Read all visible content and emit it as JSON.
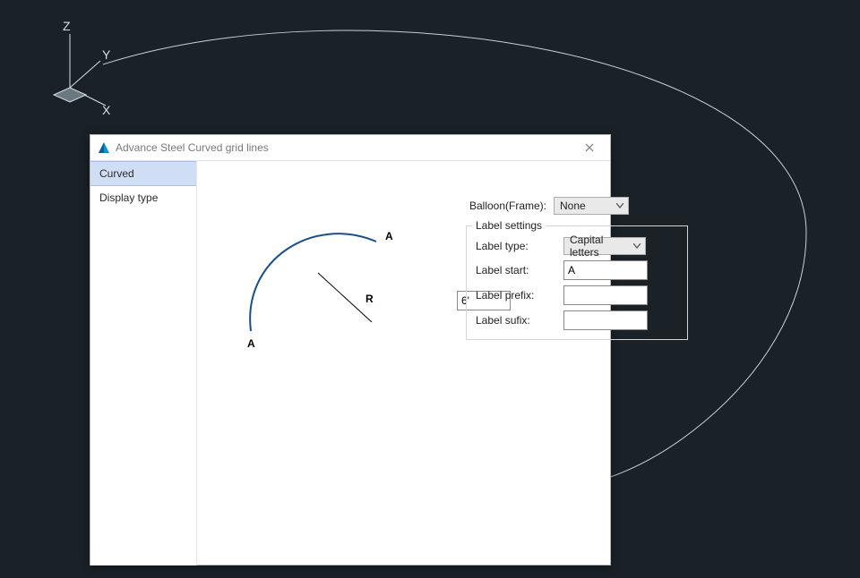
{
  "axes": {
    "z": "Z",
    "y": "Y",
    "x": "X"
  },
  "dialog": {
    "title": "Advance Steel   Curved grid lines",
    "sidebar": {
      "items": [
        {
          "label": "Curved",
          "selected": true
        },
        {
          "label": "Display type",
          "selected": false
        }
      ]
    },
    "preview": {
      "topLabel": "A",
      "bottomLabel": "A",
      "radiusLabel": "R"
    },
    "radiusValue": "6'",
    "balloon": {
      "label": "Balloon(Frame):",
      "value": "None"
    },
    "labelSettings": {
      "legend": "Label settings",
      "typeLabel": "Label type:",
      "typeValue": "Capital letters",
      "startLabel": "Label start:",
      "startValue": "A",
      "prefixLabel": "Label prefix:",
      "prefixValue": "",
      "suffixLabel": "Label sufix:",
      "suffixValue": ""
    }
  },
  "colors": {
    "viewportBg": "#1a2228",
    "dialogBg": "#ffffff",
    "sidebarSelected": "#cfdef5",
    "arc": "#d8dee3",
    "previewArc": "#1b4f8a"
  }
}
